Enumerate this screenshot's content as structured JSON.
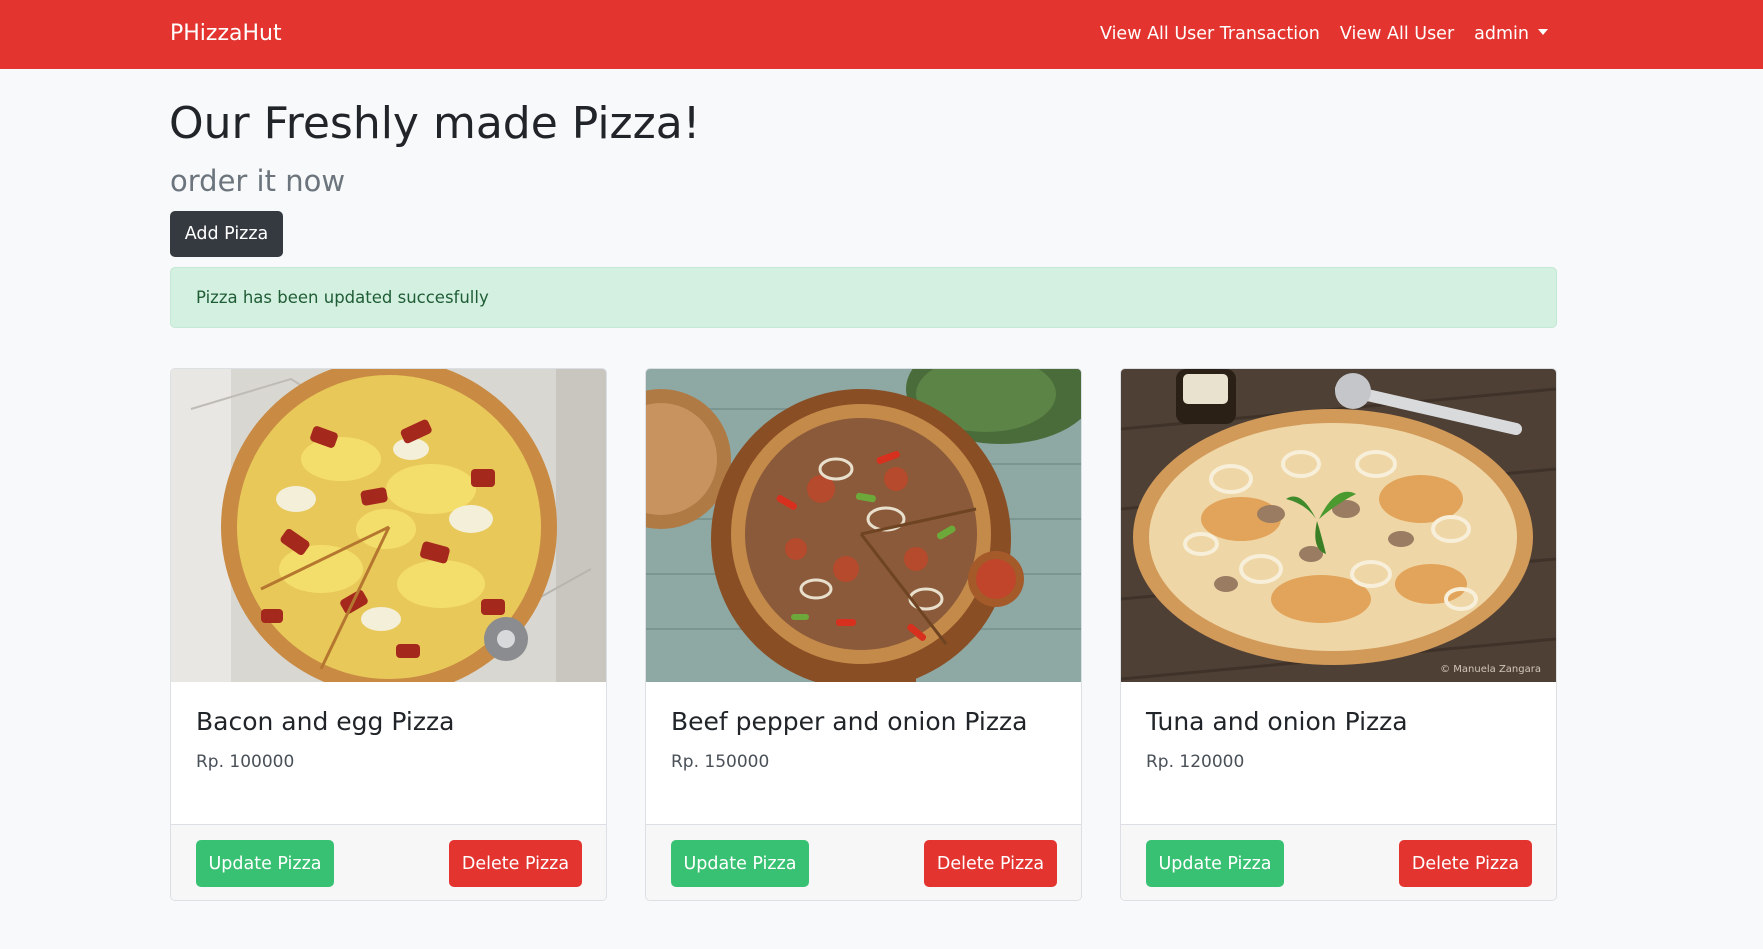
{
  "navbar": {
    "brand": "PHizzaHut",
    "links": {
      "transactions": "View All User Transaction",
      "users": "View All User",
      "account": "admin"
    }
  },
  "header": {
    "title": "Our Freshly made Pizza!",
    "subtitle": "order it now",
    "add_button": "Add Pizza"
  },
  "alert": {
    "message": "Pizza has been updated succesfully"
  },
  "pizzas": [
    {
      "name": "Bacon and egg Pizza",
      "price": "Rp. 100000",
      "update_label": "Update Pizza",
      "delete_label": "Delete Pizza"
    },
    {
      "name": "Beef pepper and onion Pizza",
      "price": "Rp. 150000",
      "update_label": "Update Pizza",
      "delete_label": "Delete Pizza"
    },
    {
      "name": "Tuna and onion Pizza",
      "price": "Rp. 120000",
      "update_label": "Update Pizza",
      "delete_label": "Delete Pizza",
      "photo_credit": "© Manuela Zangara"
    }
  ],
  "colors": {
    "navbar": "#e3342f",
    "success": "#38c172",
    "danger": "#e3342f",
    "dark": "#343a40",
    "alert_bg": "#d4f0e0"
  }
}
